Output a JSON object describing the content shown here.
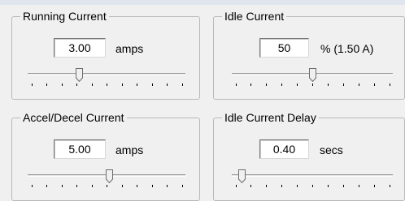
{
  "running_current": {
    "legend": "Running Current",
    "value": "3.00",
    "unit": "amps",
    "slider_position": 0.32
  },
  "idle_current": {
    "legend": "Idle Current",
    "value": "50",
    "unit": "% (1.50 A)",
    "slider_position": 0.5
  },
  "accel_decel_current": {
    "legend": "Accel/Decel Current",
    "value": "5.00",
    "unit": "amps",
    "slider_position": 0.52
  },
  "idle_current_delay": {
    "legend": "Idle Current Delay",
    "value": "0.40",
    "unit": "secs",
    "slider_position": 0.04
  },
  "slider_tick_count": 11
}
